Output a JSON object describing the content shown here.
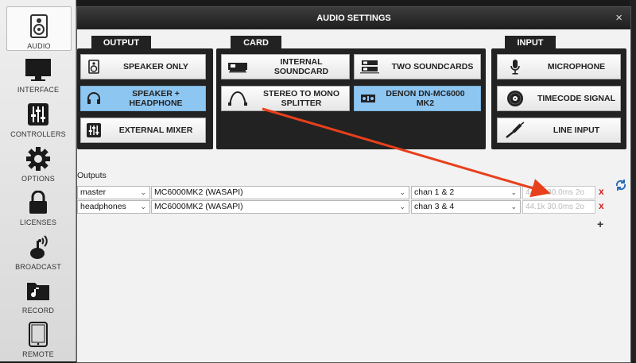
{
  "sidebar": {
    "items": [
      {
        "label": "AUDIO",
        "icon": "speaker-icon"
      },
      {
        "label": "INTERFACE",
        "icon": "monitor-icon"
      },
      {
        "label": "CONTROLLERS",
        "icon": "sliders-icon"
      },
      {
        "label": "OPTIONS",
        "icon": "gear-icon"
      },
      {
        "label": "LICENSES",
        "icon": "lock-icon"
      },
      {
        "label": "BROADCAST",
        "icon": "broadcast-icon"
      },
      {
        "label": "RECORD",
        "icon": "record-folder-icon"
      },
      {
        "label": "REMOTE",
        "icon": "tablet-icon"
      }
    ]
  },
  "dialog": {
    "title": "AUDIO SETTINGS",
    "close": "×"
  },
  "output": {
    "tab": "OUTPUT",
    "buttons": [
      {
        "label": "SPEAKER ONLY",
        "icon": "speaker-icon",
        "selected": false
      },
      {
        "label": "SPEAKER + HEADPHONE",
        "icon": "headphone-icon",
        "selected": true
      },
      {
        "label": "EXTERNAL MIXER",
        "icon": "mixer-icon",
        "selected": false
      }
    ]
  },
  "card": {
    "tab": "CARD",
    "buttons": [
      {
        "label": "INTERNAL SOUNDCARD",
        "icon": "soundcard-icon",
        "selected": false
      },
      {
        "label": "TWO SOUNDCARDS",
        "icon": "two-soundcards-icon",
        "selected": false
      },
      {
        "label": "STEREO TO MONO SPLITTER",
        "icon": "splitter-cable-icon",
        "selected": false
      },
      {
        "label": "DENON DN-MC6000 MK2",
        "icon": "controller-icon",
        "selected": true
      }
    ]
  },
  "input": {
    "tab": "INPUT",
    "buttons": [
      {
        "label": "MICROPHONE",
        "icon": "microphone-icon",
        "selected": false
      },
      {
        "label": "TIMECODE SIGNAL",
        "icon": "vinyl-icon",
        "selected": false
      },
      {
        "label": "LINE INPUT",
        "icon": "jack-icon",
        "selected": false
      }
    ]
  },
  "outputs": {
    "label": "Outputs",
    "rows": [
      {
        "channel": "master",
        "device": "MC6000MK2 (WASAPI)",
        "chan": "chan 1 & 2",
        "info": "44.1k 30.0ms 2o"
      },
      {
        "channel": "headphones",
        "device": "MC6000MK2 (WASAPI)",
        "chan": "chan 3 & 4",
        "info": "44.1k 30.0ms 2o"
      }
    ],
    "add": "+",
    "delete": "x"
  },
  "colors": {
    "selected": "#8ec6f2",
    "arrow": "#e8401c",
    "panel": "#222222"
  }
}
